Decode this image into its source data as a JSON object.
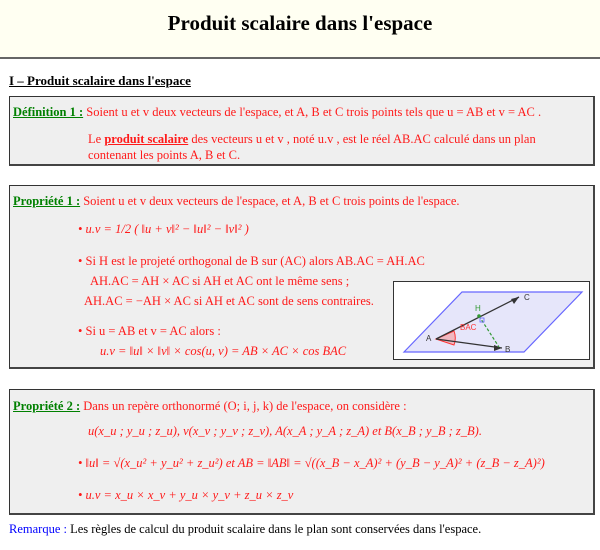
{
  "header": {
    "title": "Produit scalaire dans l'espace"
  },
  "section": {
    "title": "I – Produit scalaire dans l'espace"
  },
  "definition1": {
    "label": "Définition 1 :",
    "line1": "Soient u et v deux vecteurs de l'espace, et A, B et C trois points tels que u = AB et v = AC .",
    "line2_prefix": "Le",
    "line2_term": "produit scalaire",
    "line2_rest": "des vecteurs u et v , noté u.v , est le réel AB.AC calculé dans un plan",
    "line3": "contenant les points A, B et C."
  },
  "property1": {
    "label": "Propriété 1 :",
    "intro": "Soient u et v deux vecteurs de l'espace, et A, B et C trois points de l'espace.",
    "formula1": "• u.v = 1/2 ( ‖u + v‖² − ‖u‖² − ‖v‖² )",
    "bullet2_line1": "• Si H est le projeté orthogonal de B sur (AC) alors AB.AC = AH.AC",
    "bullet2_line2": "AH.AC = AH × AC si AH et AC ont le même sens ;",
    "bullet2_line3": "AH.AC = −AH × AC si AH et AC sont de sens contraires.",
    "bullet3_line1": "• Si u = AB et v = AC alors :",
    "bullet3_line2": "u.v = ‖u‖ × ‖v‖ × cos(u, v) = AB × AC × cos BAC",
    "figure": {
      "labels": {
        "A": "A",
        "B": "B",
        "C": "C",
        "H": "H",
        "angle": "BAC"
      },
      "colors": {
        "plane_fill": "#e6e6fa",
        "plane_stroke": "#6666ff",
        "vector": "#333333",
        "projection": "#339933",
        "angle": "#ff3333"
      }
    }
  },
  "property2": {
    "label": "Propriété 2 :",
    "intro": "Dans un repère orthonormé (O; i, j, k) de l'espace, on considère :",
    "coords": "u(x_u ; y_u ; z_u), v(x_v ; y_v ; z_v), A(x_A ; y_A ; z_A) et B(x_B ; y_B ; z_B).",
    "norm": "• ‖u‖ = √(x_u² + y_u² + z_u²) et AB = ‖AB‖ = √((x_B − x_A)² + (y_B − y_A)² + (z_B − z_A)²)",
    "dot": "• u.v = x_u × x_v + y_u × y_v + z_u × z_v"
  },
  "remark": {
    "label": "Remarque :",
    "text": "Les règles de calcul du produit scalaire dans le plan sont conservées dans l'espace."
  },
  "colors": {
    "definition_text": "#ff1a1a",
    "label_green": "#008000",
    "remark_blue": "#0000ff",
    "box_bg": "#efefef",
    "header_bg": "#fffff2"
  }
}
